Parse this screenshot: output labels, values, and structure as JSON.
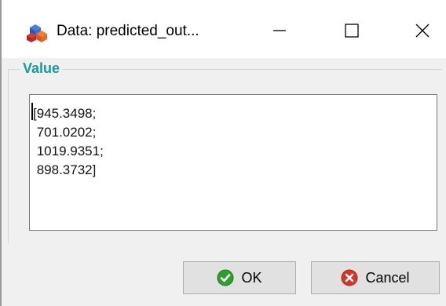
{
  "window": {
    "title": "Data: predicted_out...",
    "icon": "app-cubes-icon"
  },
  "titlebar_controls": {
    "minimize": "minimize-icon",
    "maximize": "maximize-icon",
    "close": "close-icon"
  },
  "group": {
    "label": "Value"
  },
  "value_lines": [
    "[945.3498;",
    " 701.0202;",
    " 1019.9351;",
    " 898.3732]"
  ],
  "buttons": {
    "ok_label": "OK",
    "cancel_label": "Cancel"
  },
  "colors": {
    "group_label": "#1a9a9a",
    "ok_icon": "#2e9e2e",
    "cancel_icon": "#d8352a"
  }
}
